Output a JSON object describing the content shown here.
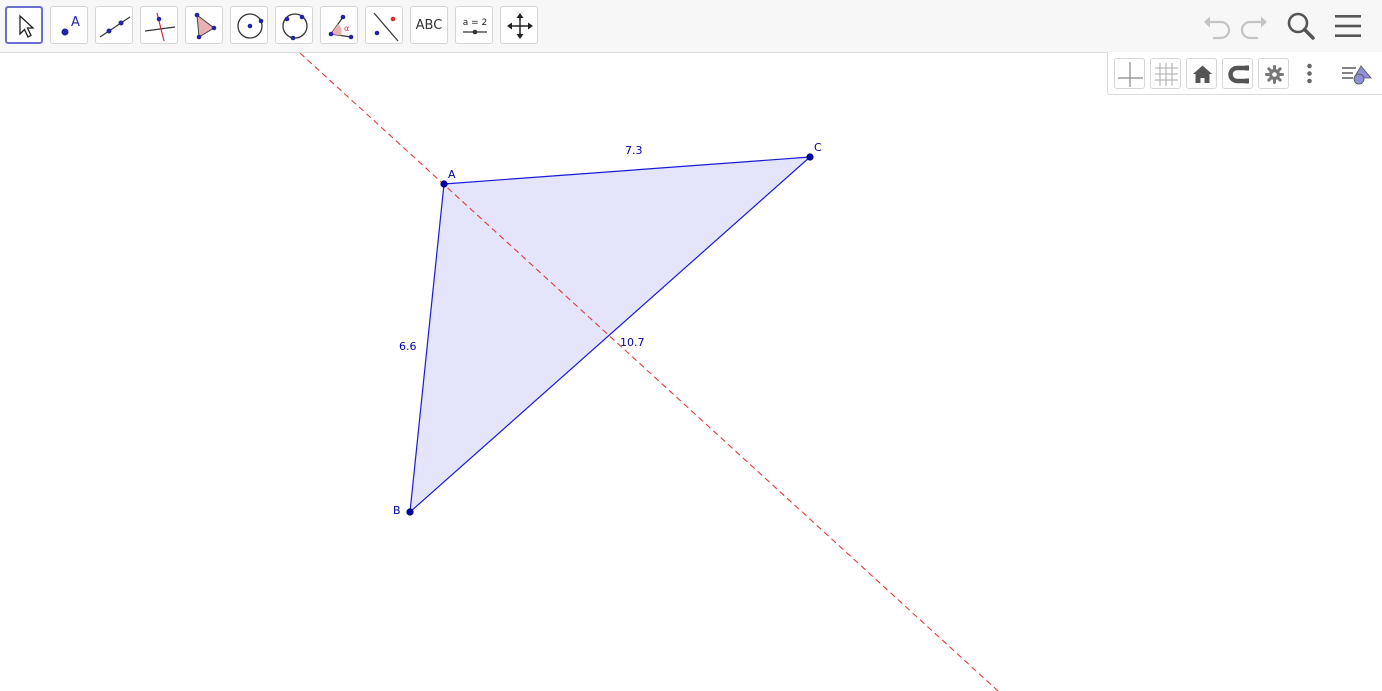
{
  "toolbar": {
    "tools": [
      {
        "id": "move",
        "icon": "cursor-arrow-icon",
        "active": true
      },
      {
        "id": "point",
        "icon": "point-icon",
        "glyph": "A"
      },
      {
        "id": "line",
        "icon": "line-through-points-icon"
      },
      {
        "id": "perpendicular",
        "icon": "perpendicular-line-icon"
      },
      {
        "id": "polygon",
        "icon": "polygon-icon"
      },
      {
        "id": "circle-center-point",
        "icon": "circle-center-icon"
      },
      {
        "id": "circle-three-points",
        "icon": "circle-three-points-icon"
      },
      {
        "id": "angle",
        "icon": "angle-icon",
        "glyph": "α"
      },
      {
        "id": "reflect",
        "icon": "reflect-about-line-icon"
      },
      {
        "id": "text",
        "icon": "text-icon",
        "label": "ABC"
      },
      {
        "id": "slider",
        "icon": "slider-icon",
        "label": "a = 2"
      },
      {
        "id": "move-graphics",
        "icon": "move-graphics-view-icon"
      }
    ],
    "right": {
      "undo_icon": "undo-icon",
      "redo_icon": "redo-icon",
      "search_icon": "search-icon",
      "menu_icon": "hamburger-menu-icon"
    }
  },
  "style_bar": {
    "buttons": [
      "axes-icon",
      "grid-icon",
      "home-icon",
      "magnet-icon",
      "gear-icon",
      "more-vertical-icon",
      "style-bar-toggle-icon"
    ]
  },
  "construction": {
    "points": {
      "A": "A",
      "B": "B",
      "C": "C"
    },
    "side_lengths": {
      "AC": "7.3",
      "AB": "6.6",
      "BC": "10.7"
    },
    "colors": {
      "polygon_fill": "#e4e4fa",
      "polygon_stroke": "#1a1ad6",
      "point": "#0000a8",
      "dashed_line": "#e33b3b"
    }
  }
}
